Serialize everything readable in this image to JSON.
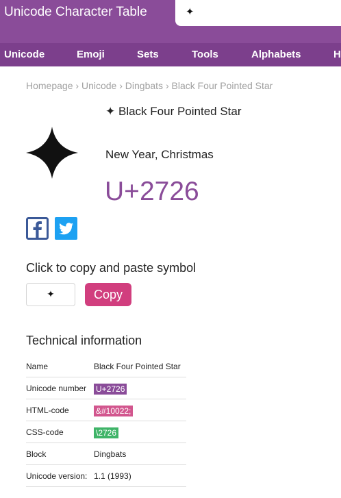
{
  "header": {
    "site_title": "Unicode Character Table",
    "search_value": "✦"
  },
  "nav": {
    "items": [
      "Unicode",
      "Emoji",
      "Sets",
      "Tools",
      "Alphabets",
      "H"
    ]
  },
  "breadcrumb": {
    "items": [
      "Homepage",
      "Unicode",
      "Dingbats",
      "Black Four Pointed Star"
    ],
    "separator": "›"
  },
  "character": {
    "glyph": "✦",
    "name": "Black Four Pointed Star",
    "tags": "New Year, Christmas",
    "codepoint": "U+2726"
  },
  "share": {
    "facebook_icon": "facebook-icon",
    "twitter_icon": "twitter-icon",
    "facebook_color": "#3b5998",
    "twitter_color": "#1da1f2"
  },
  "copy": {
    "title": "Click to copy and paste symbol",
    "value": "✦",
    "button_label": "Copy"
  },
  "tech": {
    "title": "Technical information",
    "rows": [
      {
        "key": "Name",
        "value": "Black Four Pointed Star"
      },
      {
        "key": "Unicode number",
        "value": "U+2726"
      },
      {
        "key": "HTML-code",
        "value": "&#10022;"
      },
      {
        "key": "CSS-code",
        "value": "\\2726"
      },
      {
        "key": "Block",
        "value": "Dingbats"
      },
      {
        "key": "Unicode version:",
        "value": "1.1 (1993)"
      }
    ]
  },
  "colors": {
    "brand": "#8a4c99",
    "nav": "#7c3f8c",
    "copy_button": "#d13e7e",
    "badge_purple": "#8a4c99",
    "badge_pink": "#d2568e",
    "badge_green": "#3fb468",
    "link": "#5b88b8"
  }
}
